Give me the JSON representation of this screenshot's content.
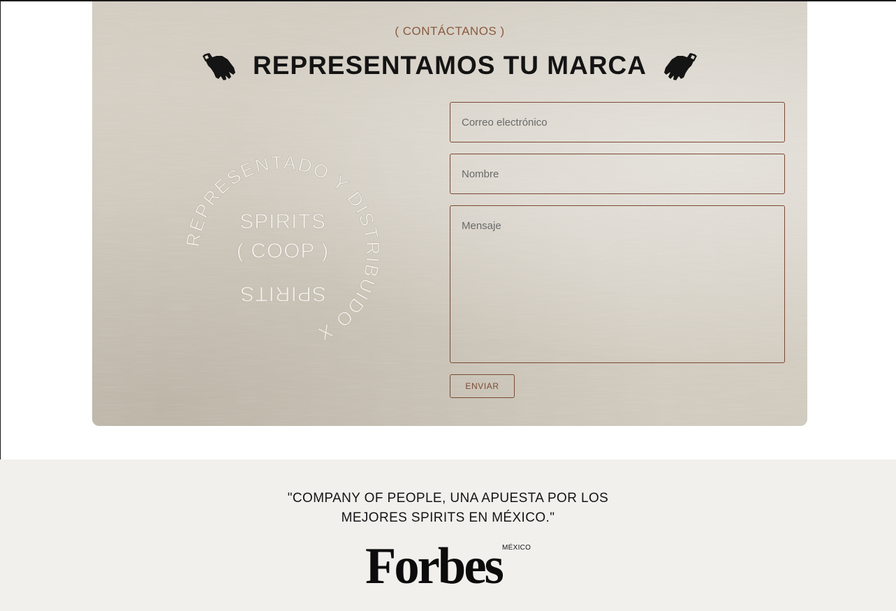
{
  "contact": {
    "eyebrow": "( CONTÁCTANOS )",
    "title": "REPRESENTAMOS TU MARCA",
    "stamp": {
      "outer_text": "REPRESENTADO Y DISTRIBUIDO X",
      "inner_top": "SPIRITS",
      "inner_middle": "(  COOP  )",
      "inner_bottom": "SPIRITS"
    },
    "form": {
      "email_placeholder": "Correo electrónico",
      "email_value": "",
      "name_placeholder": "Nombre",
      "name_value": "",
      "message_placeholder": "Mensaje",
      "message_value": "",
      "submit_label": "ENVIAR"
    }
  },
  "press": {
    "quote_line1": "\"COMPANY OF PEOPLE, UNA APUESTA POR LOS",
    "quote_line2": "MEJORES SPIRITS EN MÉXICO.\"",
    "logo_word": "Forbes",
    "logo_country": "MÉXICO"
  },
  "colors": {
    "accent_brown": "#7a4a32",
    "eyebrow_brown": "#8a5a3e",
    "paper": "#d8d2c7",
    "press_background": "#f1f0ec",
    "text_dark": "#141414"
  },
  "icons": {
    "left": "open-hand-left-icon",
    "right": "open-hand-right-icon"
  }
}
